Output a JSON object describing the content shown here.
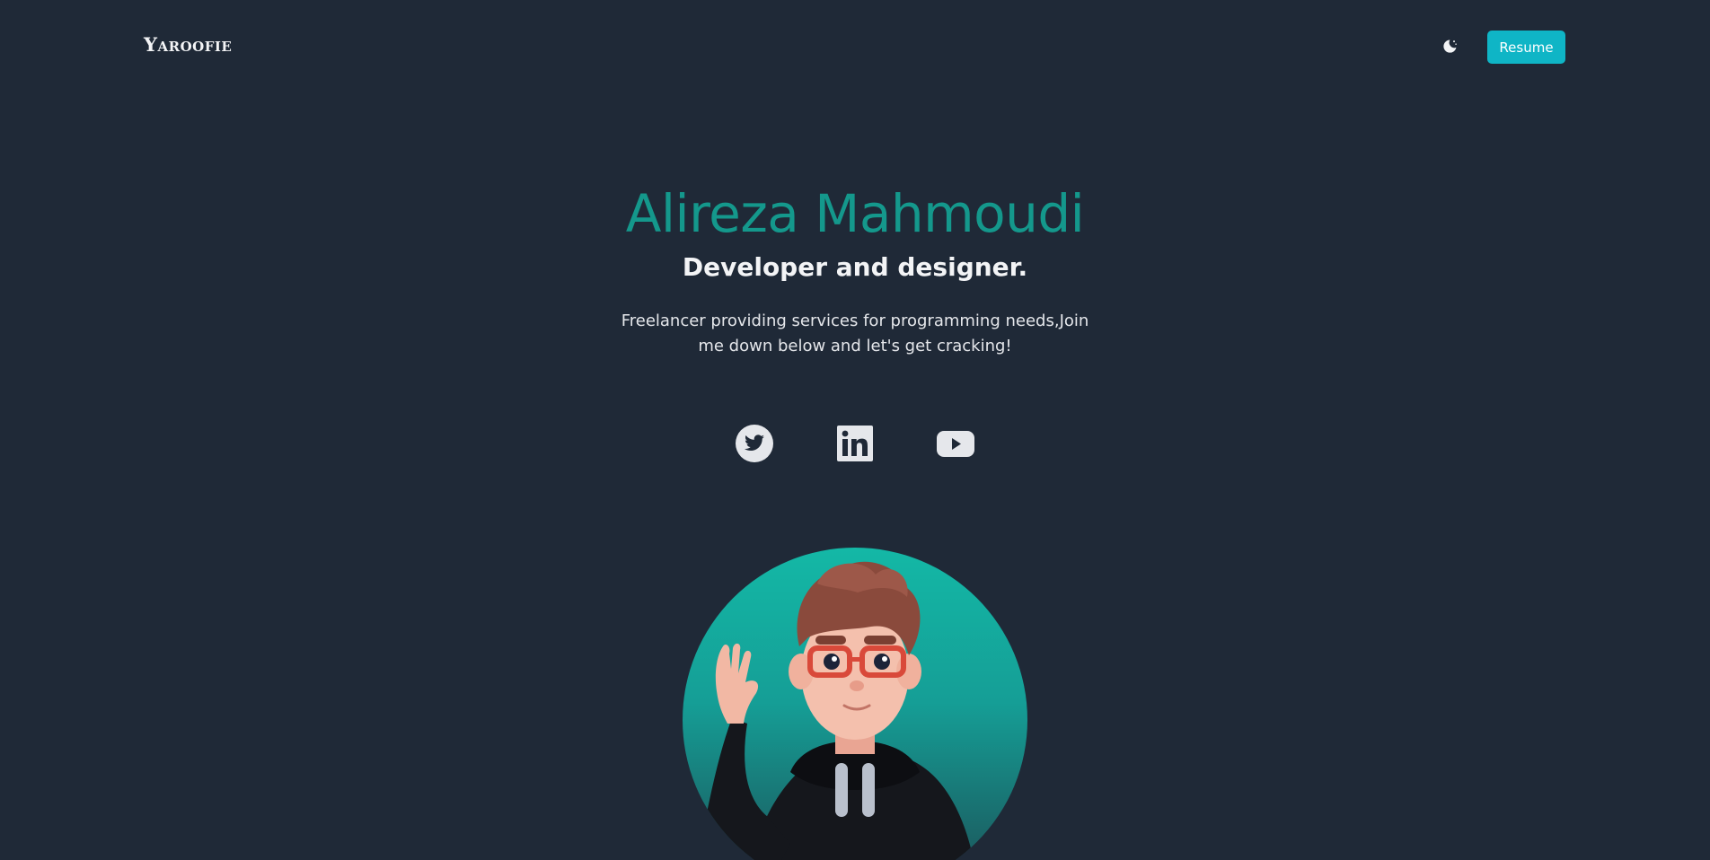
{
  "header": {
    "logo": "Yaroofie",
    "theme_toggle_icon": "moon-icon",
    "resume_label": "Resume",
    "accent_color": "#0fb5c6"
  },
  "hero": {
    "name": "Alireza Mahmoudi",
    "role": "Developer and designer.",
    "description": "Freelancer providing services for programming needs,Join me down below and let's get cracking!",
    "name_color": "#14988c"
  },
  "socials": [
    {
      "icon": "twitter-icon"
    },
    {
      "icon": "linkedin-icon"
    },
    {
      "icon": "youtube-icon"
    }
  ],
  "avatar": {
    "icon": "avatar-illustration",
    "gradient": [
      "#14b8a6",
      "#1c4f55"
    ]
  },
  "colors": {
    "background": "#1f2937",
    "text": "#e5e7eb"
  }
}
